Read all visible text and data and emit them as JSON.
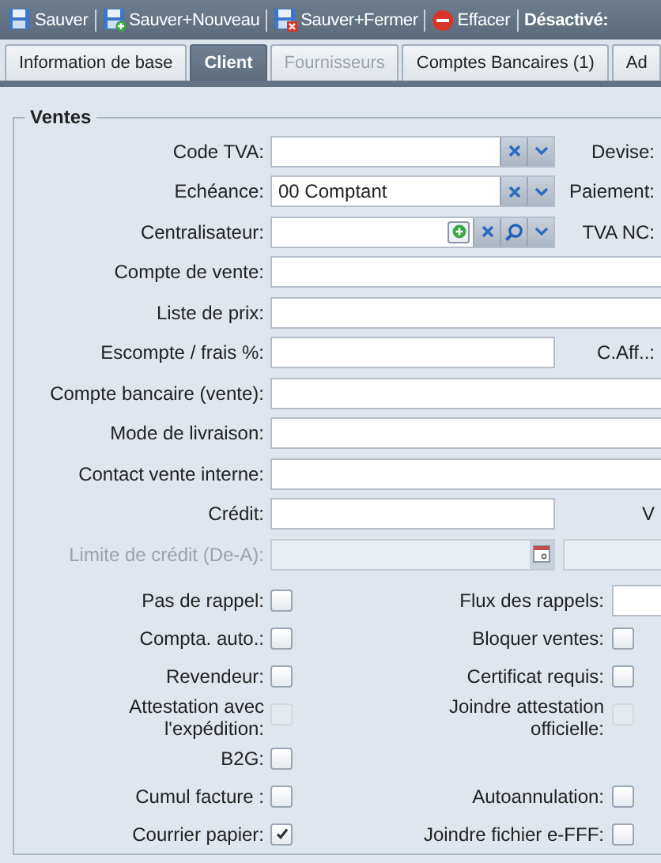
{
  "toolbar": {
    "buttons": [
      {
        "label": "Sauver"
      },
      {
        "label": "Sauver+Nouveau"
      },
      {
        "label": "Sauver+Fermer"
      },
      {
        "label": "Effacer"
      }
    ],
    "trailing_label": "Désactivé:"
  },
  "tabs": [
    {
      "label": "Information de base",
      "selected": false,
      "disabled": false
    },
    {
      "label": "Client",
      "selected": true,
      "disabled": false
    },
    {
      "label": "Fournisseurs",
      "selected": false,
      "disabled": true
    },
    {
      "label": "Comptes Bancaires (1)",
      "selected": false,
      "disabled": false
    },
    {
      "label": "Ad",
      "selected": false,
      "disabled": false
    }
  ],
  "section": {
    "title": "Ventes",
    "rows": [
      {
        "kind": "combo",
        "label": "Code TVA:",
        "disabled": false,
        "right_label": "Devise:"
      },
      {
        "kind": "combo",
        "label": "Echéance:",
        "disabled": false,
        "value": "00 Comptant",
        "right_label": "Paiement:"
      },
      {
        "kind": "lookup",
        "label": "Centralisateur:",
        "disabled": false,
        "right_label": "TVA NC:"
      },
      {
        "kind": "wide",
        "label": "Compte de vente:",
        "disabled": false
      },
      {
        "kind": "wide",
        "label": "Liste de prix:",
        "disabled": false
      },
      {
        "kind": "half",
        "label": "Escompte / frais %:",
        "disabled": false,
        "right_label": "C.Aff..:"
      },
      {
        "kind": "wide",
        "label": "Compte bancaire (vente):",
        "disabled": false
      },
      {
        "kind": "wide",
        "label": "Mode de livraison:",
        "disabled": false
      },
      {
        "kind": "wide",
        "label": "Contact vente interne:",
        "disabled": false
      },
      {
        "kind": "half",
        "label": "Crédit:",
        "disabled": false,
        "right_label": "V"
      },
      {
        "kind": "daterange",
        "label": "Limite de crédit (De-A):",
        "disabled": true
      }
    ],
    "checkbox_rows": [
      {
        "left": {
          "label": "Pas de rappel:",
          "checked": false,
          "disabled": false
        },
        "right": {
          "kind": "field",
          "label": "Flux des rappels:"
        }
      },
      {
        "left": {
          "label": "Compta. auto.:",
          "checked": false,
          "disabled": false
        },
        "right": {
          "kind": "checkbox",
          "label": "Bloquer ventes:",
          "checked": false,
          "disabled": false
        }
      },
      {
        "left": {
          "label": "Revendeur:",
          "checked": false,
          "disabled": false
        },
        "right": {
          "kind": "checkbox",
          "label": "Certificat requis:",
          "checked": false,
          "disabled": false
        }
      },
      {
        "left": {
          "label": "Attestation avec l'expédition:",
          "checked": false,
          "disabled": true
        },
        "right": {
          "kind": "checkbox",
          "label": "Joindre attestation officielle:",
          "checked": false,
          "disabled": true
        }
      },
      {
        "left": {
          "label": "B2G:",
          "checked": false,
          "disabled": false
        }
      },
      {
        "left": {
          "label": "Cumul facture :",
          "checked": false,
          "disabled": false
        },
        "right": {
          "kind": "checkbox",
          "label": "Autoannulation:",
          "checked": false,
          "disabled": false
        }
      },
      {
        "left": {
          "label": "Courrier papier:",
          "checked": true,
          "disabled": false
        },
        "right": {
          "kind": "checkbox",
          "label": "Joindre fichier e-FFF:",
          "checked": false,
          "disabled": false
        }
      }
    ]
  }
}
